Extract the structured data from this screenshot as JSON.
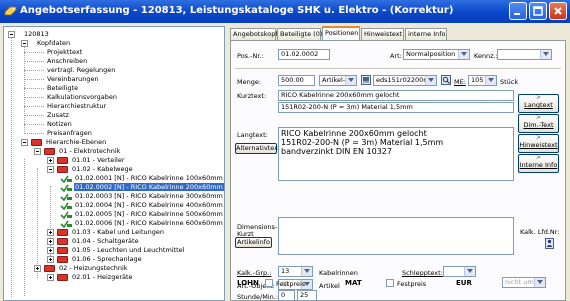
{
  "window": {
    "title": "Angebotserfassung - 120813, Leistungskataloge SHK u. Elektro - (Korrektur)"
  },
  "tree": {
    "rows": [
      {
        "label": "120813"
      },
      {
        "label": "Kopfdaten"
      },
      {
        "label": "Projekttext"
      },
      {
        "label": "Anschreiben"
      },
      {
        "label": "vertragl. Regelungen"
      },
      {
        "label": "Vereinbarungen"
      },
      {
        "label": "Beteiligte"
      },
      {
        "label": "Kalkulationsvorgaben"
      },
      {
        "label": "Hierarchiestruktur"
      },
      {
        "label": "Zusatz"
      },
      {
        "label": "Notizen"
      },
      {
        "label": "Preisanfragen"
      },
      {
        "label": "Hierarchie-Ebenen"
      },
      {
        "label": "01 - Elektrotechnik"
      },
      {
        "label": "01.01 - Verteiler"
      },
      {
        "label": "01.02 - Kabelwege"
      },
      {
        "label": "01.02.0001 [N] - RICO Kabelrinne 100x60mm ge"
      },
      {
        "label": "01.02.0002 [N] - RICO Kabelrinne 200x60mm ge"
      },
      {
        "label": "01.02.0003 [N] - RICO Kabelrinne 300x60mm ge"
      },
      {
        "label": "01.02.0004 [N] - RICO Kabelrinne 400x60mm ge"
      },
      {
        "label": "01.02.0005 [N] - RICO Kabelrinne 500x60mm ge"
      },
      {
        "label": "01.02.0006 [N] - RICO Kabelrinne 600x60mm ge"
      },
      {
        "label": "01.03 - Kabel und Leitungen"
      },
      {
        "label": "01.04 - Schaltgeräte"
      },
      {
        "label": "01.05 - Leuchten und Leuchtmittel"
      },
      {
        "label": "01.06 - Sprechanlage"
      },
      {
        "label": "02 - Heizungstechnik"
      },
      {
        "label": "02.01 - Heizgeräte"
      }
    ]
  },
  "tabs": [
    {
      "label": "Angebotskopf"
    },
    {
      "label": "Beteiligte (0)"
    },
    {
      "label": "Positionen"
    },
    {
      "label": "Hinweistext"
    },
    {
      "label": "interne Info"
    }
  ],
  "form": {
    "pos_nr_label": "Pos.-Nr.:",
    "pos_nr_value": "01.02.0002",
    "art_label": "Art:",
    "art_value": "Normalposition",
    "kennz_label": "Kennz.:",
    "kennz_value": "",
    "menge_label": "Menge:",
    "menge_value": "500.00",
    "artikel_nr_value": "Artikel-Nr.:",
    "artikel_code_value": "eds151r02200n",
    "me_label": "ME:",
    "me_value": "105",
    "unit_value": "Stück",
    "kurztext_label": "Kurztext:",
    "kurztext_line1": "RICO Kabelrinne 200x60mm gelocht",
    "kurztext_line2": "151R02-200-N (P = 3m) Material 1,5mm",
    "langtext_label": "Langtext:",
    "langtext_lines": [
      "RICO Kabelrinne 200x60mm gelocht",
      "151R02-200-N (P = 3m) Material 1,5mm",
      "bandverzinkt DIN EN 10327"
    ],
    "alternativtext_button": "Alternativtext",
    "dimensions_label": "Dimensions-",
    "dimensions_label2": "Kurzt",
    "artikelinfo_button": "Artikelinfo",
    "kalk_lfd_label": "Kalk. Lfd.Nr:",
    "kalk_grp_label": "Kalk.-Grp.:",
    "kalk_grp_value": "13",
    "kalk_grp_text": "Kabelrinnen",
    "schlepptext_label": "Schlepptext:",
    "schlepptext_value": "",
    "art_objekt_label": "Art.-Objekt:",
    "art_objekt_value": "10",
    "art_objekt_text": "Artikel",
    "lohn_label": "LOHN",
    "festpreis_label": "Festpreis",
    "mat_label": "MAT",
    "festpreis2_label": "Festpreis",
    "eur_label": "EUR",
    "eur_value": "nicht umlegb",
    "stunde_label": "Stunde/Min.:",
    "stunde_value": "0",
    "min_value": "25"
  },
  "side_buttons": {
    "langtext": "Langtext",
    "dim_text": "Dim.-Text",
    "hinweistext": "Hinweistext",
    "interne_info": "Interne Info"
  },
  "colors": {
    "title_bar": "#0a46c8",
    "selection": "#316ac5",
    "tab_accent": "#e68b2c",
    "folder": "#d9342b"
  }
}
